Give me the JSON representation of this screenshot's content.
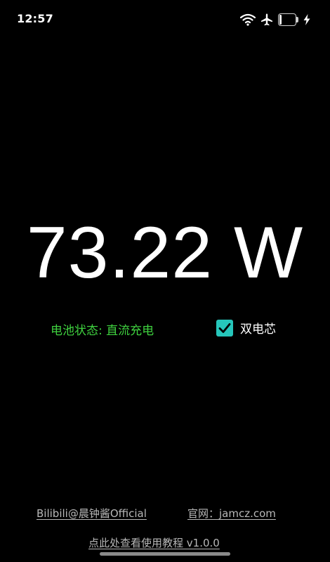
{
  "status_bar": {
    "time": "12:57",
    "battery_level": "6",
    "battery_fraction": 0.06,
    "icons": [
      "wifi-icon",
      "airplane-icon",
      "battery-icon",
      "charging-bolt-icon"
    ]
  },
  "power": {
    "reading": "73.22 W"
  },
  "battery_status": {
    "text": "电池状态: 直流充电",
    "color": "#3fd13f"
  },
  "dual_cell": {
    "label": "双电芯",
    "checked": true,
    "accent": "#26c6bb"
  },
  "footer": {
    "bilibili_link": "Bilibili@晨钟酱Official",
    "website_link": "官网：jamcz.com",
    "tutorial_link": "点此处查看使用教程  v1.0.0"
  }
}
